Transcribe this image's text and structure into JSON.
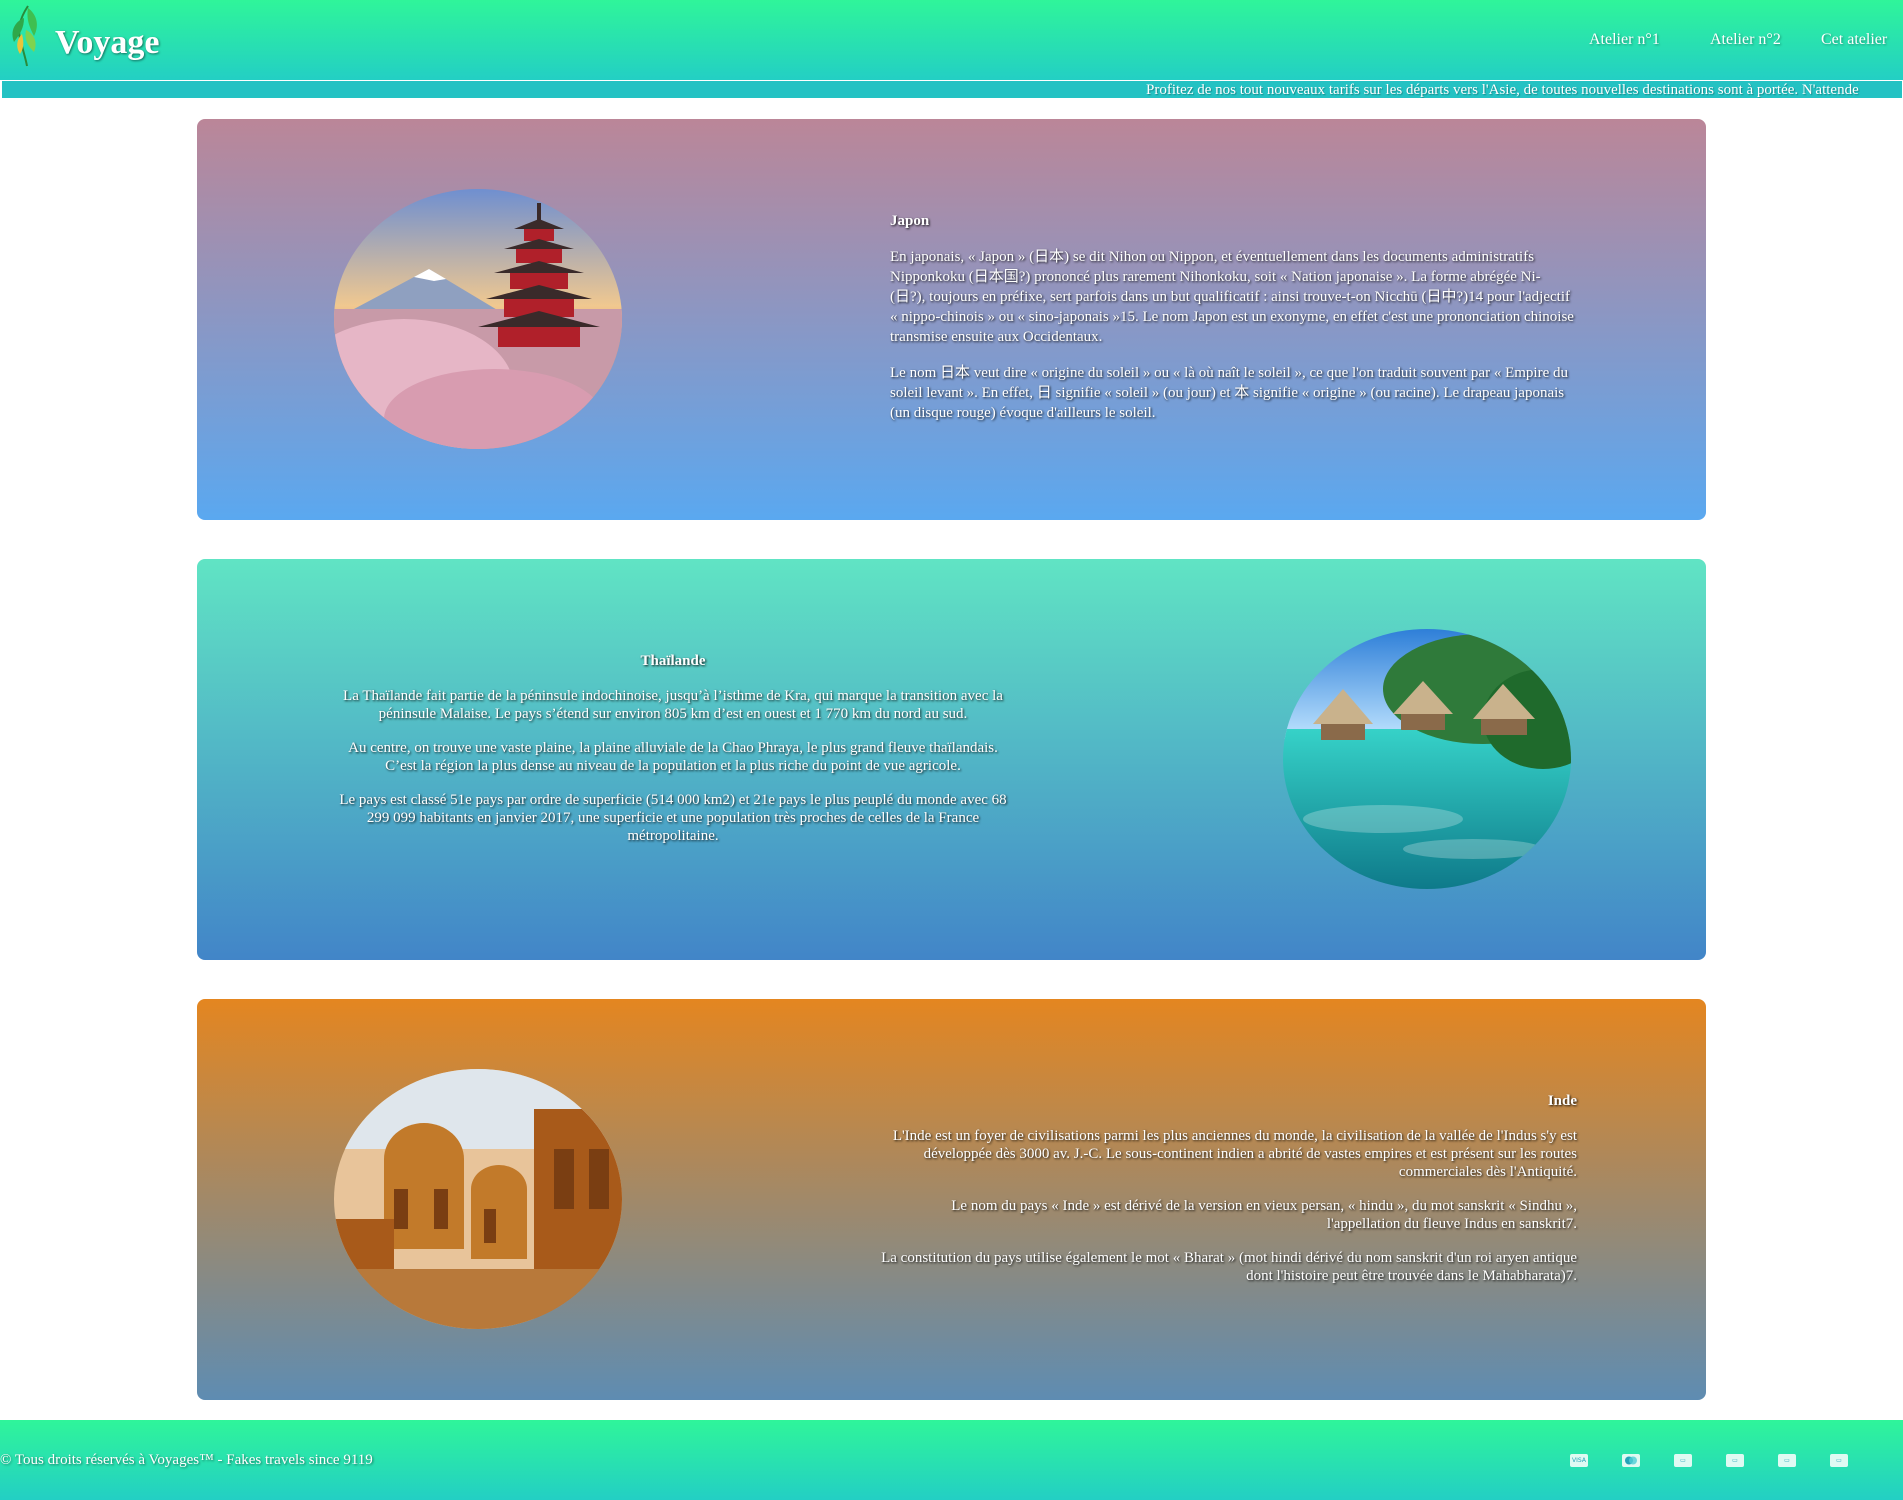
{
  "header": {
    "brand": "Voyage",
    "nav": [
      "Atelier n°1",
      "Atelier n°2",
      "Cet atelier"
    ]
  },
  "ticker": {
    "text": "Profitez de nos tout nouveaux tarifs sur les départs vers l'Asie, de toutes nouvelles destinations sont à portée. N'attende"
  },
  "countries": [
    {
      "title": "Japon",
      "paragraphs": [
        "En japonais, « Japon » (日本) se dit Nihon ou Nippon, et éventuellement dans les documents administratifs Nipponkoku (日本国?) prononcé plus rarement Nihonkoku, soit « Nation japonaise ». La forme abrégée Ni- (日?), toujours en préfixe, sert parfois dans un but qualificatif : ainsi trouve-t-on Nicchū (日中?)14 pour l'adjectif « nippo-chinois » ou « sino-japonais »15. Le nom Japon est un exonyme, en effet c'est une prononciation chinoise transmise ensuite aux Occidentaux.",
        "Le nom 日本 veut dire « origine du soleil » ou « là où naît le soleil », ce que l'on traduit souvent par « Empire du soleil levant ». En effet, 日 signifie « soleil » (ou jour) et 本 signifie « origine » (ou racine). Le drapeau japonais (un disque rouge) évoque d'ailleurs le soleil."
      ],
      "image": "pagoda-mount-fuji-cherry-blossom-photo"
    },
    {
      "title": "Thaïlande",
      "paragraphs": [
        "La Thaïlande fait partie de la péninsule indochinoise, jusqu’à l’isthme de Kra, qui marque la transition avec la péninsule Malaise. Le pays s’étend sur environ 805 km d’est en ouest et 1 770 km du nord au sud.",
        "Au centre, on trouve une vaste plaine, la plaine alluviale de la Chao Phraya, le plus grand fleuve thaïlandais. C’est la région la plus dense au niveau de la population et la plus riche du point de vue agricole.",
        "Le pays est classé 51e pays par ordre de superficie (514 000 km2) et 21e pays le plus peuplé du monde avec 68 299 099 habitants en janvier 2017, une superficie et une population très proches de celles de la France métropolitaine."
      ],
      "image": "overwater-bungalows-lagoon-photo"
    },
    {
      "title": "Inde",
      "paragraphs": [
        "L'Inde est un foyer de civilisations parmi les plus anciennes du monde, la civilisation de la vallée de l'Indus s'y est développée dès 3000 av. J.-C. Le sous-continent indien a abrité de vastes empires et est présent sur les routes commerciales dès l'Antiquité.",
        "Le nom du pays « Inde » est dérivé de la version en vieux persan, « hindu », du mot sanskrit « Sindhu », l'appellation du fleuve Indus en sanskrit7.",
        "La constitution du pays utilise également le mot « Bharat » (mot hindi dérivé du nom sanskrit d'un roi aryen antique dont l'histoire peut être trouvée dans le Mahabharata)7."
      ],
      "image": "sandstone-cenotaphs-photo"
    }
  ],
  "footer": {
    "copyright": "© Tous droits réservés à Voyages™ - Fakes travels since 9119",
    "payment_icons": [
      "visa-icon",
      "mastercard-icon",
      "card-icon",
      "card-icon",
      "card-icon",
      "card-icon"
    ]
  }
}
